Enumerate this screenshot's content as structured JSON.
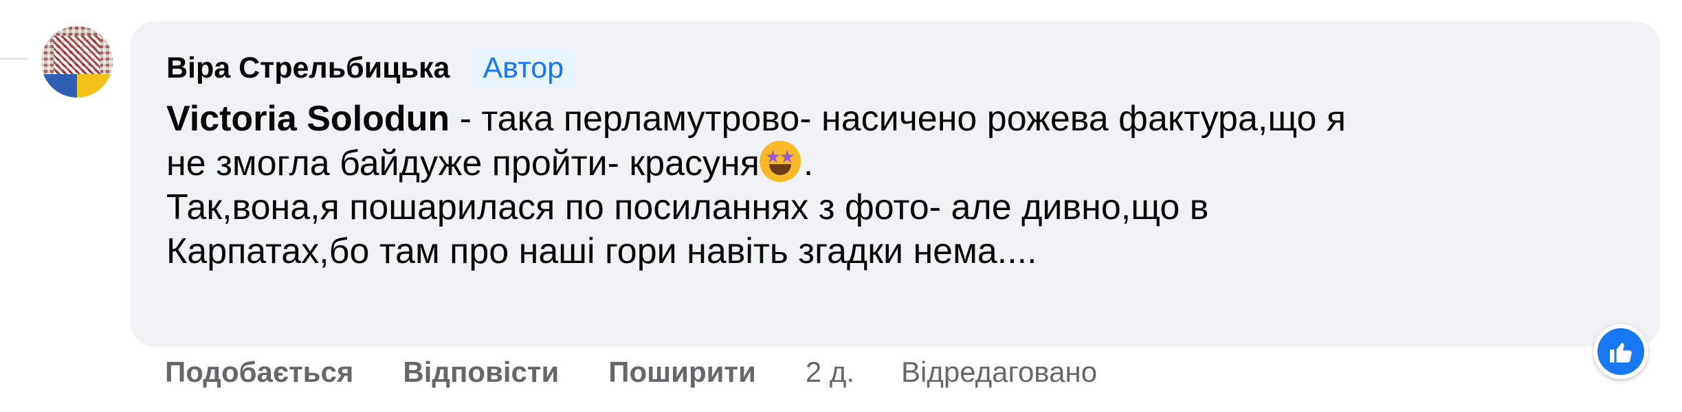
{
  "comment": {
    "author": "Віра Стрельбицька",
    "author_badge": "Автор",
    "mention": "Victoria Solodun",
    "text_line1_rest": " - така перламутрово- насичено рожева фактура,що я",
    "text_line2": "не змогла байдуже пройти- красуня",
    "text_line2_end": ".",
    "text_line3": "Так,вона,я пошарилася по посиланнях з фото- але дивно,що в",
    "text_line4": "Карпатах,бо там про наші гори навіть згадки нема....",
    "emoji": "star-struck-emoji",
    "reaction": "like-icon"
  },
  "actions": {
    "like": "Подобається",
    "reply": "Відповісти",
    "share": "Поширити",
    "time": "2 д.",
    "edited": "Відредаговано"
  },
  "colors": {
    "bubble": "#f0f2f5",
    "accent": "#1877f2",
    "muted": "#65676b"
  }
}
